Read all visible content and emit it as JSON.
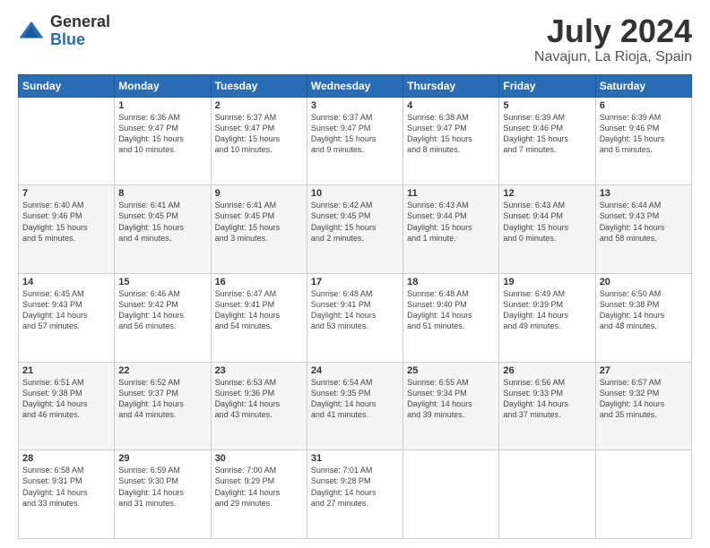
{
  "logo": {
    "general": "General",
    "blue": "Blue"
  },
  "header": {
    "month": "July 2024",
    "location": "Navajun, La Rioja, Spain"
  },
  "days_of_week": [
    "Sunday",
    "Monday",
    "Tuesday",
    "Wednesday",
    "Thursday",
    "Friday",
    "Saturday"
  ],
  "weeks": [
    [
      {
        "day": "",
        "info": ""
      },
      {
        "day": "1",
        "info": "Sunrise: 6:36 AM\nSunset: 9:47 PM\nDaylight: 15 hours\nand 10 minutes."
      },
      {
        "day": "2",
        "info": "Sunrise: 6:37 AM\nSunset: 9:47 PM\nDaylight: 15 hours\nand 10 minutes."
      },
      {
        "day": "3",
        "info": "Sunrise: 6:37 AM\nSunset: 9:47 PM\nDaylight: 15 hours\nand 9 minutes."
      },
      {
        "day": "4",
        "info": "Sunrise: 6:38 AM\nSunset: 9:47 PM\nDaylight: 15 hours\nand 8 minutes."
      },
      {
        "day": "5",
        "info": "Sunrise: 6:39 AM\nSunset: 9:46 PM\nDaylight: 15 hours\nand 7 minutes."
      },
      {
        "day": "6",
        "info": "Sunrise: 6:39 AM\nSunset: 9:46 PM\nDaylight: 15 hours\nand 6 minutes."
      }
    ],
    [
      {
        "day": "7",
        "info": "Sunrise: 6:40 AM\nSunset: 9:46 PM\nDaylight: 15 hours\nand 5 minutes."
      },
      {
        "day": "8",
        "info": "Sunrise: 6:41 AM\nSunset: 9:45 PM\nDaylight: 15 hours\nand 4 minutes."
      },
      {
        "day": "9",
        "info": "Sunrise: 6:41 AM\nSunset: 9:45 PM\nDaylight: 15 hours\nand 3 minutes."
      },
      {
        "day": "10",
        "info": "Sunrise: 6:42 AM\nSunset: 9:45 PM\nDaylight: 15 hours\nand 2 minutes."
      },
      {
        "day": "11",
        "info": "Sunrise: 6:43 AM\nSunset: 9:44 PM\nDaylight: 15 hours\nand 1 minute."
      },
      {
        "day": "12",
        "info": "Sunrise: 6:43 AM\nSunset: 9:44 PM\nDaylight: 15 hours\nand 0 minutes."
      },
      {
        "day": "13",
        "info": "Sunrise: 6:44 AM\nSunset: 9:43 PM\nDaylight: 14 hours\nand 58 minutes."
      }
    ],
    [
      {
        "day": "14",
        "info": "Sunrise: 6:45 AM\nSunset: 9:43 PM\nDaylight: 14 hours\nand 57 minutes."
      },
      {
        "day": "15",
        "info": "Sunrise: 6:46 AM\nSunset: 9:42 PM\nDaylight: 14 hours\nand 56 minutes."
      },
      {
        "day": "16",
        "info": "Sunrise: 6:47 AM\nSunset: 9:41 PM\nDaylight: 14 hours\nand 54 minutes."
      },
      {
        "day": "17",
        "info": "Sunrise: 6:48 AM\nSunset: 9:41 PM\nDaylight: 14 hours\nand 53 minutes."
      },
      {
        "day": "18",
        "info": "Sunrise: 6:48 AM\nSunset: 9:40 PM\nDaylight: 14 hours\nand 51 minutes."
      },
      {
        "day": "19",
        "info": "Sunrise: 6:49 AM\nSunset: 9:39 PM\nDaylight: 14 hours\nand 49 minutes."
      },
      {
        "day": "20",
        "info": "Sunrise: 6:50 AM\nSunset: 9:38 PM\nDaylight: 14 hours\nand 48 minutes."
      }
    ],
    [
      {
        "day": "21",
        "info": "Sunrise: 6:51 AM\nSunset: 9:38 PM\nDaylight: 14 hours\nand 46 minutes."
      },
      {
        "day": "22",
        "info": "Sunrise: 6:52 AM\nSunset: 9:37 PM\nDaylight: 14 hours\nand 44 minutes."
      },
      {
        "day": "23",
        "info": "Sunrise: 6:53 AM\nSunset: 9:36 PM\nDaylight: 14 hours\nand 43 minutes."
      },
      {
        "day": "24",
        "info": "Sunrise: 6:54 AM\nSunset: 9:35 PM\nDaylight: 14 hours\nand 41 minutes."
      },
      {
        "day": "25",
        "info": "Sunrise: 6:55 AM\nSunset: 9:34 PM\nDaylight: 14 hours\nand 39 minutes."
      },
      {
        "day": "26",
        "info": "Sunrise: 6:56 AM\nSunset: 9:33 PM\nDaylight: 14 hours\nand 37 minutes."
      },
      {
        "day": "27",
        "info": "Sunrise: 6:57 AM\nSunset: 9:32 PM\nDaylight: 14 hours\nand 35 minutes."
      }
    ],
    [
      {
        "day": "28",
        "info": "Sunrise: 6:58 AM\nSunset: 9:31 PM\nDaylight: 14 hours\nand 33 minutes."
      },
      {
        "day": "29",
        "info": "Sunrise: 6:59 AM\nSunset: 9:30 PM\nDaylight: 14 hours\nand 31 minutes."
      },
      {
        "day": "30",
        "info": "Sunrise: 7:00 AM\nSunset: 9:29 PM\nDaylight: 14 hours\nand 29 minutes."
      },
      {
        "day": "31",
        "info": "Sunrise: 7:01 AM\nSunset: 9:28 PM\nDaylight: 14 hours\nand 27 minutes."
      },
      {
        "day": "",
        "info": ""
      },
      {
        "day": "",
        "info": ""
      },
      {
        "day": "",
        "info": ""
      }
    ]
  ]
}
